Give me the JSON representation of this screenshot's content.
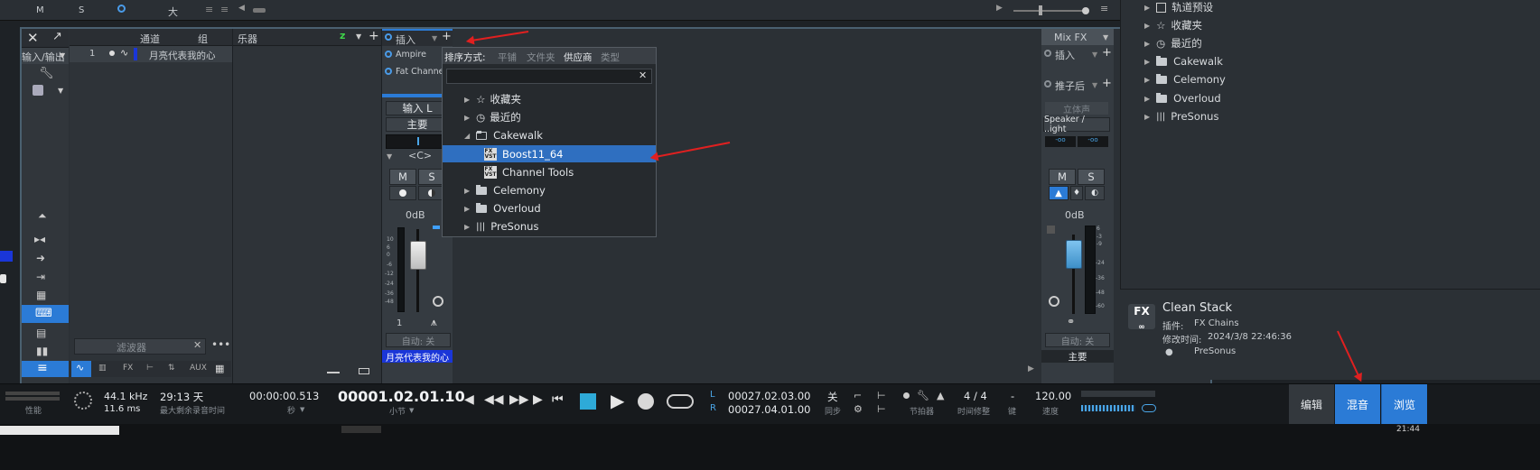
{
  "top_strip": {
    "m": "M",
    "s": "S",
    "big": "大"
  },
  "mixer": {
    "channel_list": {
      "col_channel": "通道",
      "col_group": "组",
      "io_label": "输入/输出",
      "row_number": "1",
      "row_name": "月亮代表我的心",
      "filter_placeholder": "滤波器"
    },
    "instruments_header": "乐器",
    "strip1": {
      "inserts_label": "插入",
      "plugins": [
        "Ampire",
        "Fat Channel"
      ],
      "input": "输入 L",
      "output": "主要",
      "pan": "<C>",
      "m": "M",
      "s": "S",
      "level": "0dB",
      "scale": [
        "10",
        "6",
        "0",
        "-6",
        "-12",
        "-24",
        "-36",
        "-48"
      ],
      "channel_number": "1",
      "auto": "自动: 关",
      "name": "月亮代表我的心"
    },
    "main_strip": {
      "mixfx": "Mix FX",
      "inserts_label": "插入",
      "post_label": "推子后",
      "mono": "立体声",
      "output": "Speaker / ..ight",
      "m": "M",
      "s": "S",
      "level": "0dB",
      "scale": [
        "6",
        "-3",
        "-9",
        "-24",
        "-36",
        "-48",
        "-60"
      ],
      "auto": "自动: 关",
      "name": "主要"
    },
    "bottom_tabs": [
      "FX",
      "AUX"
    ]
  },
  "popup": {
    "sort_label": "排序方式:",
    "sort_options": [
      "平铺",
      "文件夹",
      "供应商",
      "类型"
    ],
    "sort_selected": "供应商",
    "items": [
      {
        "label": "收藏夹",
        "kind": "star"
      },
      {
        "label": "最近的",
        "kind": "clock"
      },
      {
        "label": "Cakewalk",
        "kind": "folder-open"
      },
      {
        "label": "Boost11_64",
        "kind": "fx",
        "selected": true
      },
      {
        "label": "Channel Tools",
        "kind": "fx"
      },
      {
        "label": "Celemony",
        "kind": "folder"
      },
      {
        "label": "Overloud",
        "kind": "folder"
      },
      {
        "label": "PreSonus",
        "kind": "presonus"
      }
    ]
  },
  "browser": {
    "items": [
      "轨道预设",
      "收藏夹",
      "最近的",
      "Cakewalk",
      "Celemony",
      "Overloud",
      "PreSonus"
    ],
    "info": {
      "title": "Clean Stack",
      "plugin_label": "插件:",
      "plugin_value": "FX Chains",
      "modified_label": "修改时间:",
      "modified_value": "2024/3/8 22:46:36",
      "vendor": "PreSonus",
      "icon_text": "FX"
    }
  },
  "transport": {
    "perf_label": "性能",
    "sample_rate": "44.1 kHz",
    "latency": "11.6 ms",
    "remaining": "29:13 天",
    "remaining_label": "最大剩余录音时间",
    "seconds_value": "00:00:00.513",
    "seconds_label": "秒",
    "bars_value": "00001.02.01.10",
    "bars_label": "小节",
    "loop_l": "00027.02.03.00",
    "loop_r": "00027.04.01.00",
    "l": "L",
    "r": "R",
    "sync": "关",
    "sync_label": "同步",
    "metronome_label": "节拍器",
    "time_sig": "4 / 4",
    "time_sig_label": "时间修整",
    "key": "-",
    "key_label": "键",
    "tempo": "120.00",
    "tempo_label": "速度",
    "tabs": [
      "编辑",
      "混音",
      "浏览"
    ],
    "active_tab": "混音",
    "clock_partial": "21:44"
  },
  "colors": {
    "selection": "#2f6fc0",
    "accent_blue": "#2b7bd6",
    "arrow": "#e02020",
    "channel_blue": "#1a36d8"
  }
}
